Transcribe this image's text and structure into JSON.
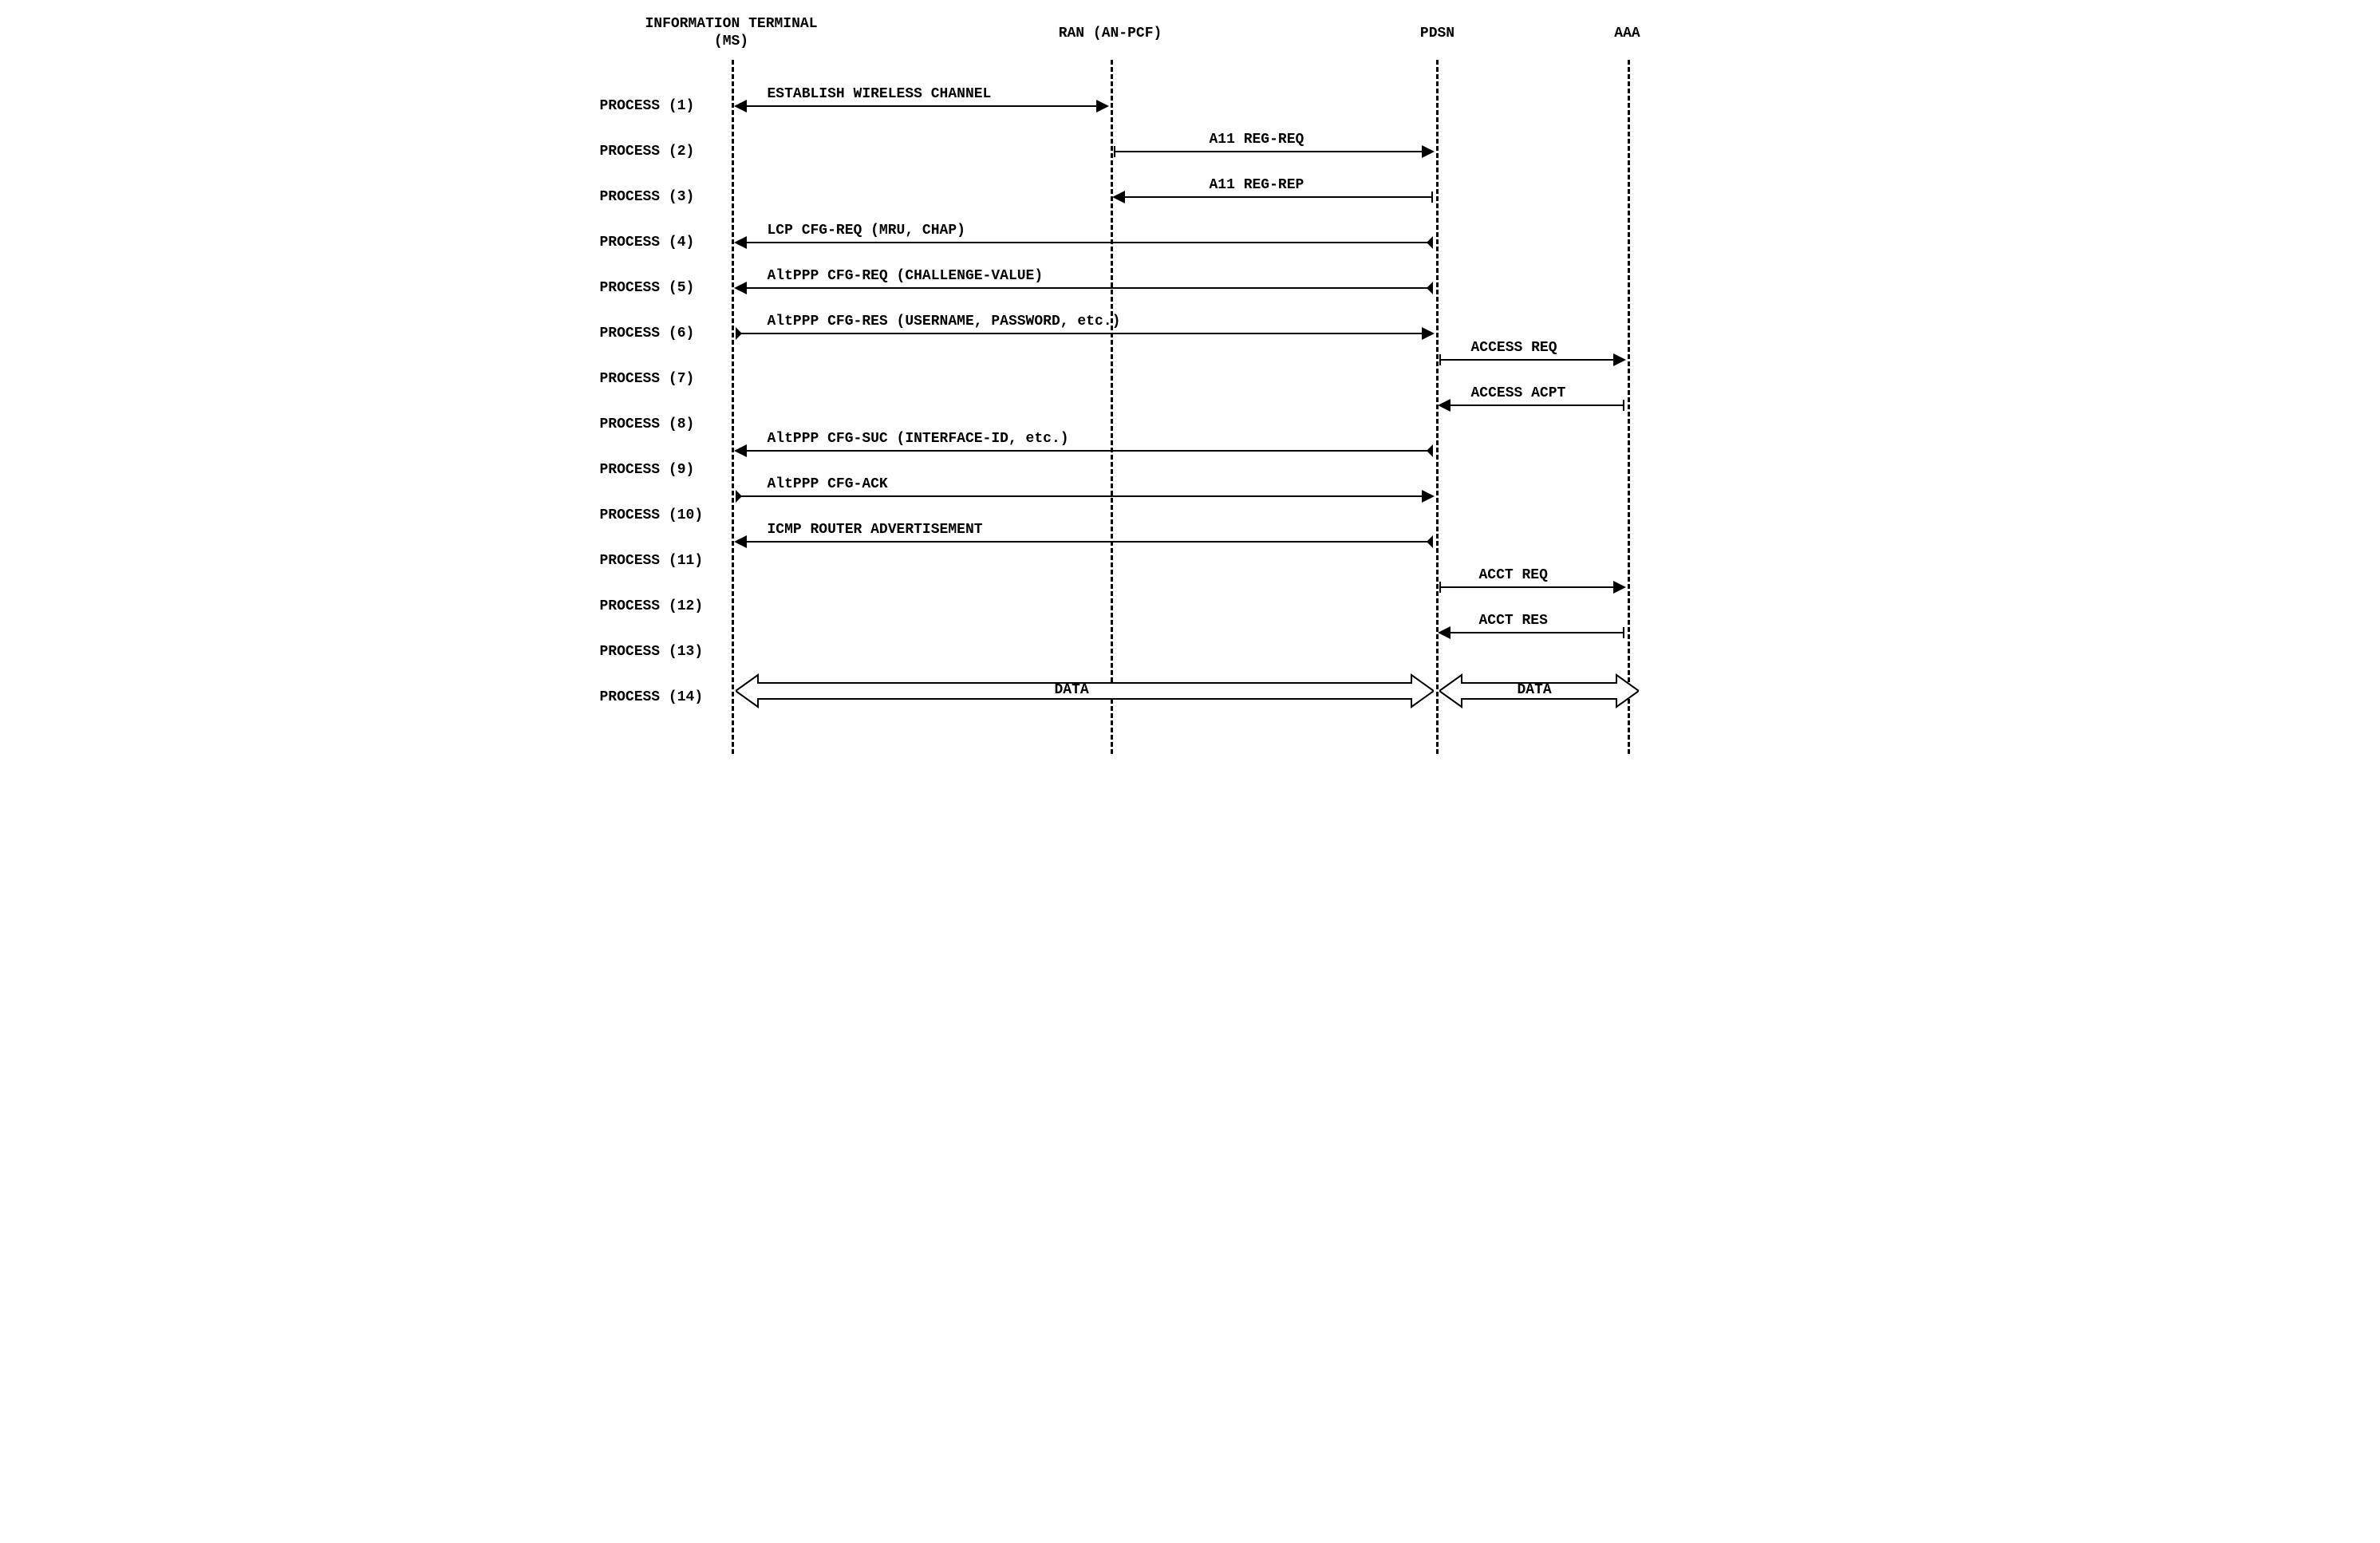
{
  "lifelines": {
    "ms": {
      "label_line1": "INFORMATION TERMINAL",
      "label_line2": "(MS)"
    },
    "ran": {
      "label": "RAN (AN-PCF)"
    },
    "pdsn": {
      "label": "PDSN"
    },
    "aaa": {
      "label": "AAA"
    }
  },
  "processes": {
    "p1": {
      "label": "PROCESS (1)",
      "msg": "ESTABLISH WIRELESS CHANNEL"
    },
    "p2": {
      "label": "PROCESS (2)",
      "msg": "A11 REG-REQ"
    },
    "p3": {
      "label": "PROCESS (3)",
      "msg": "A11 REG-REP"
    },
    "p4": {
      "label": "PROCESS (4)",
      "msg": "LCP CFG-REQ (MRU, CHAP)"
    },
    "p5": {
      "label": "PROCESS (5)",
      "msg": "AltPPP CFG-REQ (CHALLENGE-VALUE)"
    },
    "p6": {
      "label": "PROCESS (6)",
      "msg": "AltPPP CFG-RES (USERNAME, PASSWORD, etc.)"
    },
    "p7": {
      "label": "PROCESS (7)",
      "msg": "ACCESS REQ"
    },
    "p8": {
      "label": "PROCESS (8)",
      "msg": "ACCESS ACPT"
    },
    "p9": {
      "label": "PROCESS (9)",
      "msg": "AltPPP CFG-SUC (INTERFACE-ID, etc.)"
    },
    "p10": {
      "label": "PROCESS (10)",
      "msg": "AltPPP CFG-ACK"
    },
    "p11": {
      "label": "PROCESS (11)",
      "msg": "ICMP ROUTER ADVERTISEMENT"
    },
    "p12": {
      "label": "PROCESS (12)",
      "msg": "ACCT REQ"
    },
    "p13": {
      "label": "PROCESS (13)",
      "msg": "ACCT RES"
    },
    "p14": {
      "label": "PROCESS (14)",
      "msg1": "DATA",
      "msg2": "DATA"
    }
  },
  "chart_data": {
    "type": "sequence-diagram",
    "lifelines": [
      "INFORMATION TERMINAL (MS)",
      "RAN (AN-PCF)",
      "PDSN",
      "AAA"
    ],
    "messages": [
      {
        "step": 1,
        "from": "MS",
        "to": "RAN",
        "direction": "both",
        "label": "ESTABLISH WIRELESS CHANNEL"
      },
      {
        "step": 2,
        "from": "RAN",
        "to": "PDSN",
        "direction": "right",
        "label": "A11 REG-REQ"
      },
      {
        "step": 3,
        "from": "PDSN",
        "to": "RAN",
        "direction": "left",
        "label": "A11 REG-REP"
      },
      {
        "step": 4,
        "from": "PDSN",
        "to": "MS",
        "direction": "left",
        "label": "LCP CFG-REQ (MRU, CHAP)"
      },
      {
        "step": 5,
        "from": "PDSN",
        "to": "MS",
        "direction": "left",
        "label": "AltPPP CFG-REQ (CHALLENGE-VALUE)"
      },
      {
        "step": 6,
        "from": "MS",
        "to": "PDSN",
        "direction": "right",
        "label": "AltPPP CFG-RES (USERNAME, PASSWORD, etc.)"
      },
      {
        "step": 7,
        "from": "PDSN",
        "to": "AAA",
        "direction": "right",
        "label": "ACCESS REQ"
      },
      {
        "step": 8,
        "from": "AAA",
        "to": "PDSN",
        "direction": "left",
        "label": "ACCESS ACPT"
      },
      {
        "step": 9,
        "from": "PDSN",
        "to": "MS",
        "direction": "left",
        "label": "AltPPP CFG-SUC (INTERFACE-ID, etc.)"
      },
      {
        "step": 10,
        "from": "MS",
        "to": "PDSN",
        "direction": "right",
        "label": "AltPPP CFG-ACK"
      },
      {
        "step": 11,
        "from": "PDSN",
        "to": "MS",
        "direction": "left",
        "label": "ICMP ROUTER ADVERTISEMENT"
      },
      {
        "step": 12,
        "from": "PDSN",
        "to": "AAA",
        "direction": "right",
        "label": "ACCT REQ"
      },
      {
        "step": 13,
        "from": "AAA",
        "to": "PDSN",
        "direction": "left",
        "label": "ACCT RES"
      },
      {
        "step": 14,
        "from": "MS",
        "to": "AAA",
        "direction": "both-hollow",
        "label": "DATA"
      }
    ]
  }
}
